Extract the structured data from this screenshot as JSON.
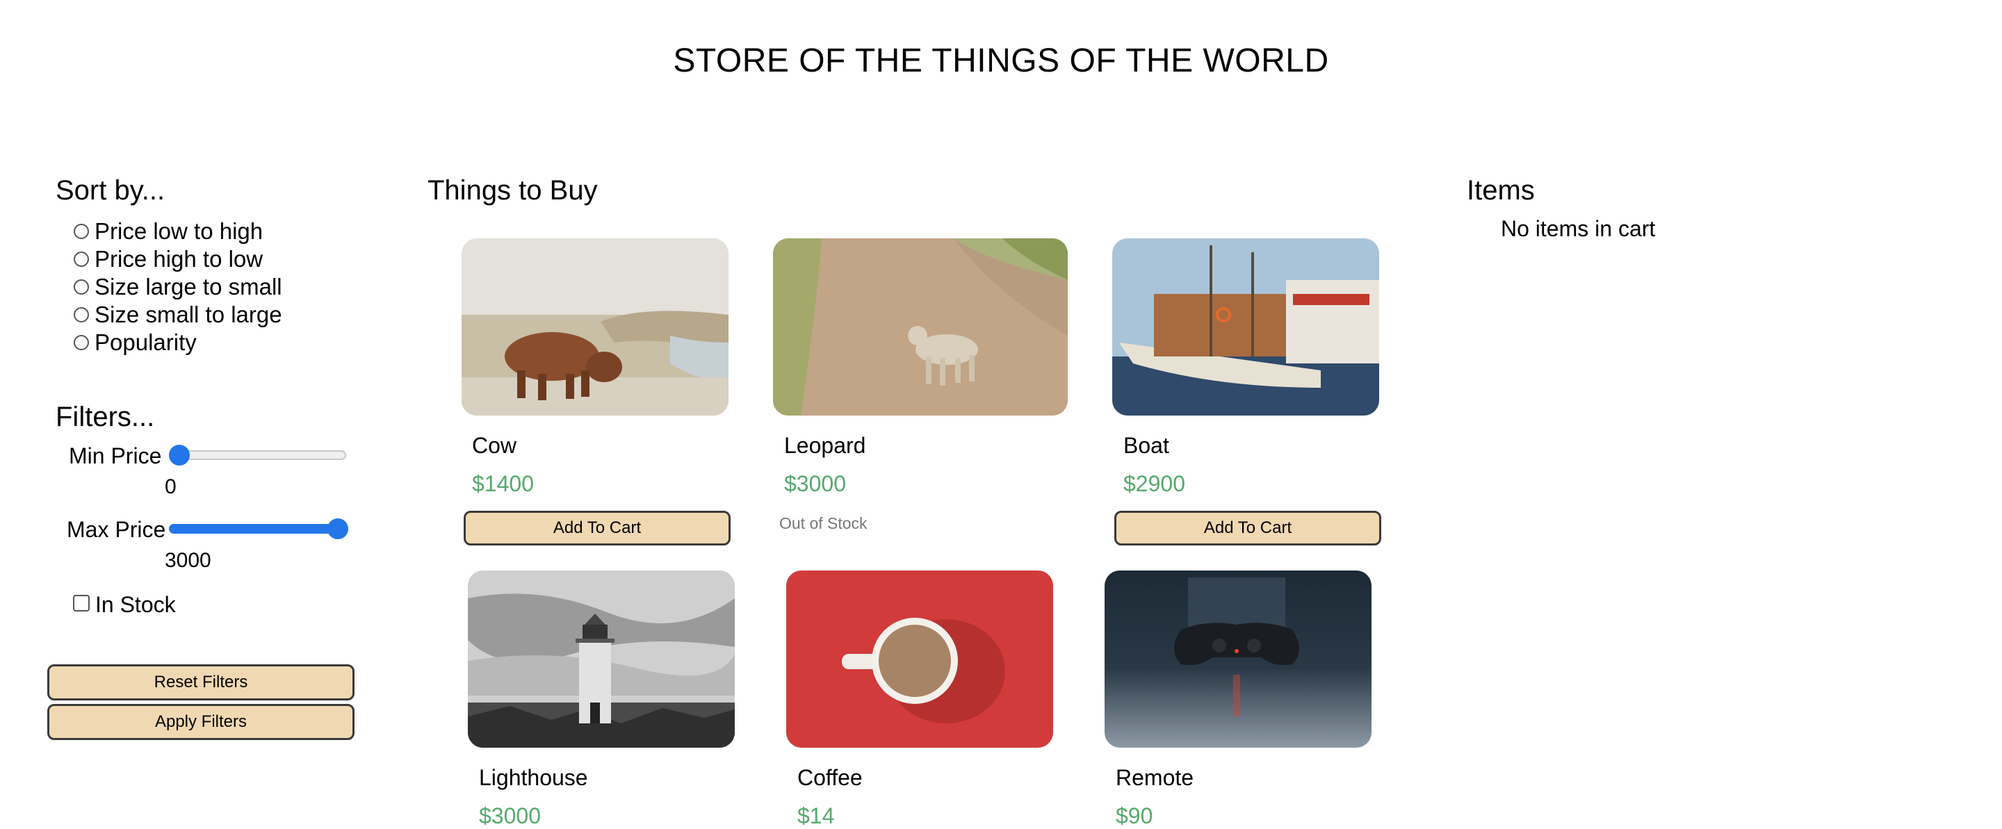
{
  "header": {
    "title": "STORE OF THE THINGS OF THE WORLD"
  },
  "sidebar": {
    "sort_heading": "Sort by...",
    "sort_options": [
      {
        "label": "Price low to high",
        "selected": false
      },
      {
        "label": "Price high to low",
        "selected": false
      },
      {
        "label": "Size large to small",
        "selected": false
      },
      {
        "label": "Size small to large",
        "selected": false
      },
      {
        "label": "Popularity",
        "selected": false
      }
    ],
    "filters_heading": "Filters...",
    "min_price": {
      "label": "Min Price",
      "value": "0",
      "range_min": 0,
      "range_max": 3000
    },
    "max_price": {
      "label": "Max Price",
      "value": "3000",
      "range_min": 0,
      "range_max": 3000
    },
    "in_stock": {
      "label": "In Stock",
      "checked": false
    },
    "reset_label": "Reset Filters",
    "apply_label": "Apply Filters"
  },
  "main": {
    "heading": "Things to Buy",
    "add_to_cart_label": "Add To Cart",
    "out_of_stock_label": "Out of Stock",
    "products": [
      {
        "name": "Cow",
        "price": "$1400",
        "in_stock": true,
        "image_icon": "highland-cow-photo"
      },
      {
        "name": "Leopard",
        "price": "$3000",
        "in_stock": false,
        "image_icon": "leopard-photo"
      },
      {
        "name": "Boat",
        "price": "$2900",
        "in_stock": true,
        "image_icon": "boat-photo"
      },
      {
        "name": "Lighthouse",
        "price": "$3000",
        "in_stock": true,
        "image_icon": "lighthouse-photo"
      },
      {
        "name": "Coffee",
        "price": "$14",
        "in_stock": true,
        "image_icon": "coffee-cup-photo"
      },
      {
        "name": "Remote",
        "price": "$90",
        "in_stock": true,
        "image_icon": "game-controller-photo"
      }
    ]
  },
  "cart": {
    "heading": "Items",
    "empty_text": "No items in cart"
  },
  "colors": {
    "price_green": "#55aa6b",
    "button_bg": "#f0d9b2",
    "slider_blue": "#2276e8"
  }
}
